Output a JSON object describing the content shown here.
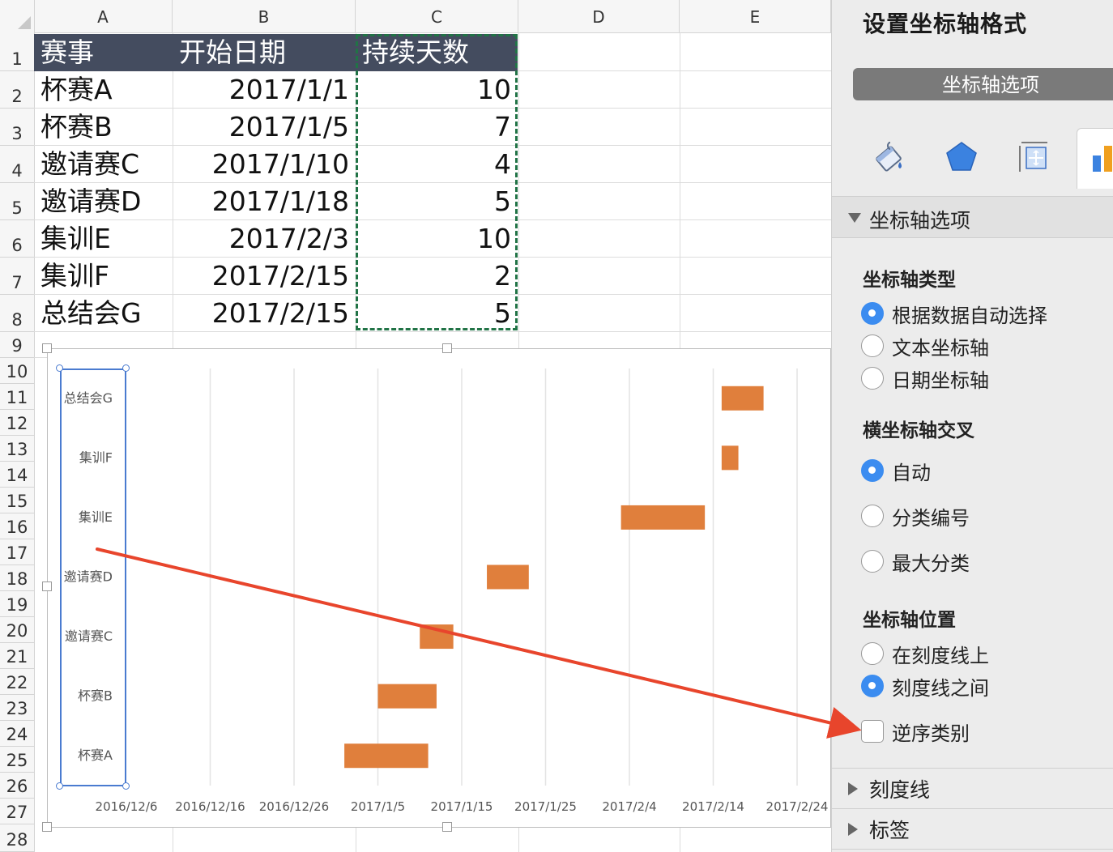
{
  "sheet": {
    "columns": [
      "A",
      "B",
      "C",
      "D",
      "E"
    ],
    "rows": [
      "1",
      "2",
      "3",
      "4",
      "5",
      "6",
      "7",
      "8",
      "9",
      "10",
      "11",
      "12",
      "13",
      "14",
      "15",
      "16",
      "17",
      "18",
      "19",
      "20",
      "21",
      "22",
      "23",
      "24",
      "25",
      "26",
      "27",
      "28"
    ],
    "headers": [
      "赛事",
      "开始日期",
      "持续天数"
    ],
    "data": [
      [
        "杯赛A",
        "2017/1/1",
        "10"
      ],
      [
        "杯赛B",
        "2017/1/5",
        "7"
      ],
      [
        "邀请赛C",
        "2017/1/10",
        "4"
      ],
      [
        "邀请赛D",
        "2017/1/18",
        "5"
      ],
      [
        "集训E",
        "2017/2/3",
        "10"
      ],
      [
        "集训F",
        "2017/2/15",
        "2"
      ],
      [
        "总结会G",
        "2017/2/15",
        "5"
      ]
    ],
    "header_bg": "#444c5f",
    "copy_marquee_color": "#217346"
  },
  "chart_data": {
    "type": "bar",
    "orientation": "horizontal-stacked-gantt",
    "categories": [
      "杯赛A",
      "杯赛B",
      "邀请赛C",
      "邀请赛D",
      "集训E",
      "集训F",
      "总结会G"
    ],
    "start": [
      "2017-01-01",
      "2017-01-05",
      "2017-01-10",
      "2017-01-18",
      "2017-02-03",
      "2017-02-15",
      "2017-02-15"
    ],
    "duration_days": [
      10,
      7,
      4,
      5,
      10,
      2,
      5
    ],
    "x_tick_labels": [
      "2016/12/6",
      "2016/12/16",
      "2016/12/26",
      "2017/1/5",
      "2017/1/15",
      "2017/1/25",
      "2017/2/4",
      "2017/2/14",
      "2017/2/24"
    ],
    "xlim": [
      "2016-12-06",
      "2017-02-24"
    ],
    "bar_color": "#e07f3c",
    "grid": "vertical-major",
    "category_order": "bottom-to-top"
  },
  "pane": {
    "title": "设置坐标轴格式",
    "tab_button": "坐标轴选项",
    "icons": [
      "fill-bucket-icon",
      "pentagon-effects-icon",
      "size-properties-icon",
      "axis-options-icon"
    ],
    "section": "坐标轴选项",
    "axis_type_title": "坐标轴类型",
    "axis_type_options": [
      "根据数据自动选择",
      "文本坐标轴",
      "日期坐标轴"
    ],
    "cross_title": "横坐标轴交叉",
    "cross_options": [
      "自动",
      "分类编号",
      "最大分类"
    ],
    "position_title": "坐标轴位置",
    "position_options": [
      "在刻度线上",
      "刻度线之间"
    ],
    "reverse_label": "逆序类别",
    "ticks_section": "刻度线",
    "labels_section": "标签",
    "accent": "#3b8cf0"
  },
  "annotation": {
    "arrow_color": "#e8452c"
  }
}
